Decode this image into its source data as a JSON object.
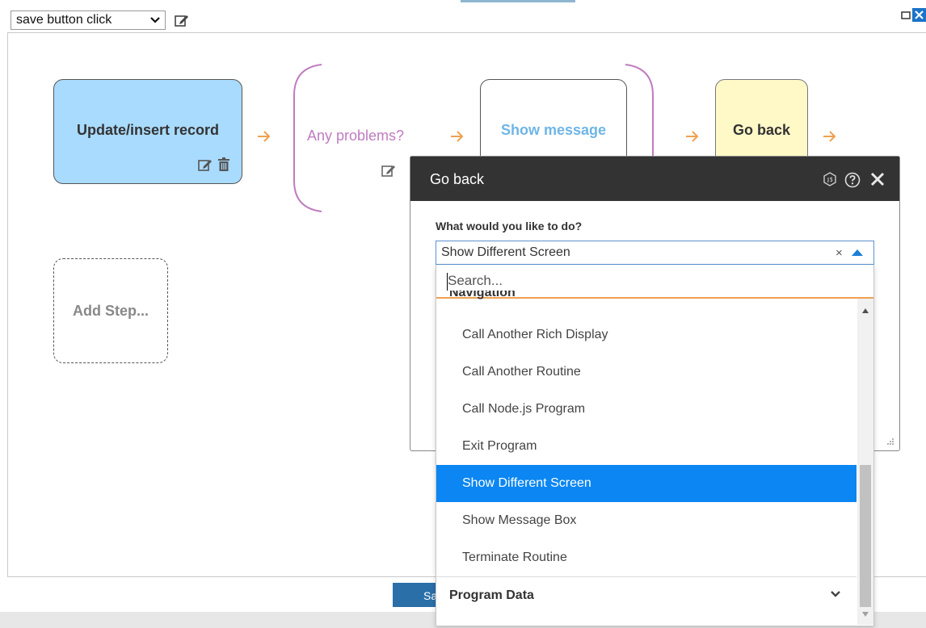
{
  "toolbar": {
    "event_select_value": "save button click"
  },
  "flow": {
    "step1_label": "Update/insert record",
    "condition_label": "Any problems?",
    "step2_label": "Show message",
    "step3_label": "Go back",
    "add_step_label": "Add Step..."
  },
  "footer": {
    "save_label": "Save"
  },
  "dialog": {
    "title": "Go back",
    "question": "What would you like to do?",
    "selected_value": "Show Different Screen",
    "clear_symbol": "×"
  },
  "dropdown": {
    "search_placeholder": "Search...",
    "group_navigation": "Navigation",
    "options": [
      "Call Another Rich Display",
      "Call Another Routine",
      "Call Node.js Program",
      "Exit Program",
      "Show Different Screen",
      "Show Message Box",
      "Terminate Routine"
    ],
    "selected_index": 4,
    "group_program_data": "Program Data"
  },
  "colors": {
    "accent_orange": "#f0a050",
    "selected_blue": "#0b86f2",
    "header_dark": "#333333",
    "step_blue": "#a9dbff",
    "step_yellow": "#fff9c8",
    "condition_purple": "#c07cc0"
  },
  "icons": {
    "edit": "edit-icon",
    "trash": "trash-icon",
    "nodejs": "nodejs-icon",
    "help": "help-icon",
    "close": "close-icon"
  }
}
